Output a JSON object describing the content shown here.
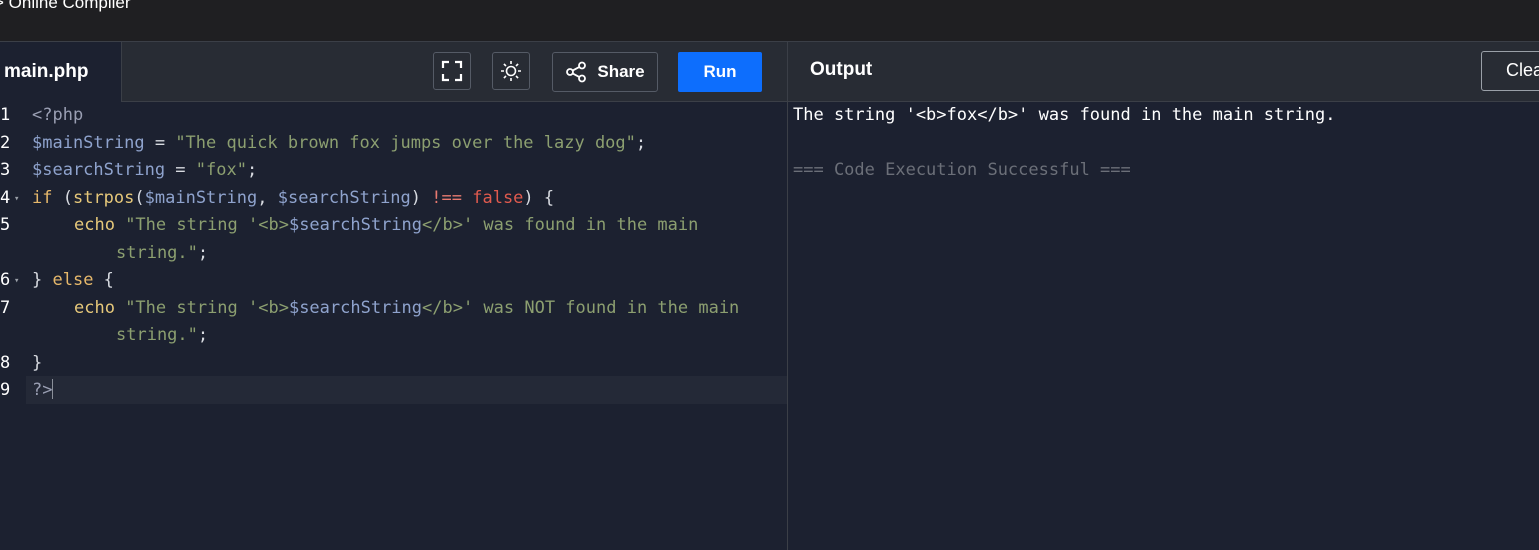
{
  "app": {
    "title": "> Online Compiler"
  },
  "editor": {
    "file_tab": "main.php",
    "share_label": "Share",
    "run_label": "Run",
    "fullscreen_icon": "fullscreen-icon",
    "theme_icon": "sun-icon",
    "share_icon": "share-icon",
    "lines": [
      {
        "number": "1",
        "segments": [
          {
            "t": "<?php",
            "c": "k-meta"
          }
        ]
      },
      {
        "number": "2",
        "segments": [
          {
            "t": "$mainString",
            "c": "k-var"
          },
          {
            "t": " = ",
            "c": "k-pun"
          },
          {
            "t": "\"The quick brown fox jumps over the lazy dog\"",
            "c": "k-str"
          },
          {
            "t": ";",
            "c": "k-pun"
          }
        ]
      },
      {
        "number": "3",
        "segments": [
          {
            "t": "$searchString",
            "c": "k-var"
          },
          {
            "t": " = ",
            "c": "k-pun"
          },
          {
            "t": "\"fox\"",
            "c": "k-str"
          },
          {
            "t": ";",
            "c": "k-pun"
          }
        ]
      },
      {
        "number": "4",
        "fold": true,
        "segments": [
          {
            "t": "if",
            "c": "k-kw"
          },
          {
            "t": " (",
            "c": "k-pun"
          },
          {
            "t": "strpos",
            "c": "k-fn"
          },
          {
            "t": "(",
            "c": "k-pun"
          },
          {
            "t": "$mainString",
            "c": "k-var"
          },
          {
            "t": ", ",
            "c": "k-pun"
          },
          {
            "t": "$searchString",
            "c": "k-var"
          },
          {
            "t": ") ",
            "c": "k-pun"
          },
          {
            "t": "!==",
            "c": "k-op"
          },
          {
            "t": " ",
            "c": "k-pun"
          },
          {
            "t": "false",
            "c": "k-bool"
          },
          {
            "t": ") {",
            "c": "k-pun"
          }
        ]
      },
      {
        "number": "5",
        "indent": true,
        "segments": [
          {
            "t": "echo",
            "c": "k-fn"
          },
          {
            "t": " \"The string '<b>",
            "c": "k-str"
          },
          {
            "t": "$searchString",
            "c": "k-var"
          },
          {
            "t": "</b>' was found in the main",
            "c": "k-str"
          }
        ]
      },
      {
        "number": "",
        "wrap": true,
        "segments": [
          {
            "t": "string.\"",
            "c": "k-str"
          },
          {
            "t": ";",
            "c": "k-pun"
          }
        ]
      },
      {
        "number": "6",
        "fold": true,
        "segments": [
          {
            "t": "} ",
            "c": "k-pun"
          },
          {
            "t": "else",
            "c": "k-kw"
          },
          {
            "t": " {",
            "c": "k-pun"
          }
        ]
      },
      {
        "number": "7",
        "indent": true,
        "segments": [
          {
            "t": "echo",
            "c": "k-fn"
          },
          {
            "t": " \"The string '<b>",
            "c": "k-str"
          },
          {
            "t": "$searchString",
            "c": "k-var"
          },
          {
            "t": "</b>' was NOT found in the main",
            "c": "k-str"
          }
        ]
      },
      {
        "number": "",
        "wrap": true,
        "segments": [
          {
            "t": "string.\"",
            "c": "k-str"
          },
          {
            "t": ";",
            "c": "k-pun"
          }
        ]
      },
      {
        "number": "8",
        "segments": [
          {
            "t": "}",
            "c": "k-pun"
          }
        ]
      },
      {
        "number": "9",
        "active": true,
        "segments": [
          {
            "t": "?>",
            "c": "k-meta"
          }
        ]
      }
    ]
  },
  "output": {
    "title": "Output",
    "clear_label": "Clear",
    "result": "The string '<b>fox</b>' was found in the main string.",
    "status": "=== Code Execution Successful ==="
  }
}
